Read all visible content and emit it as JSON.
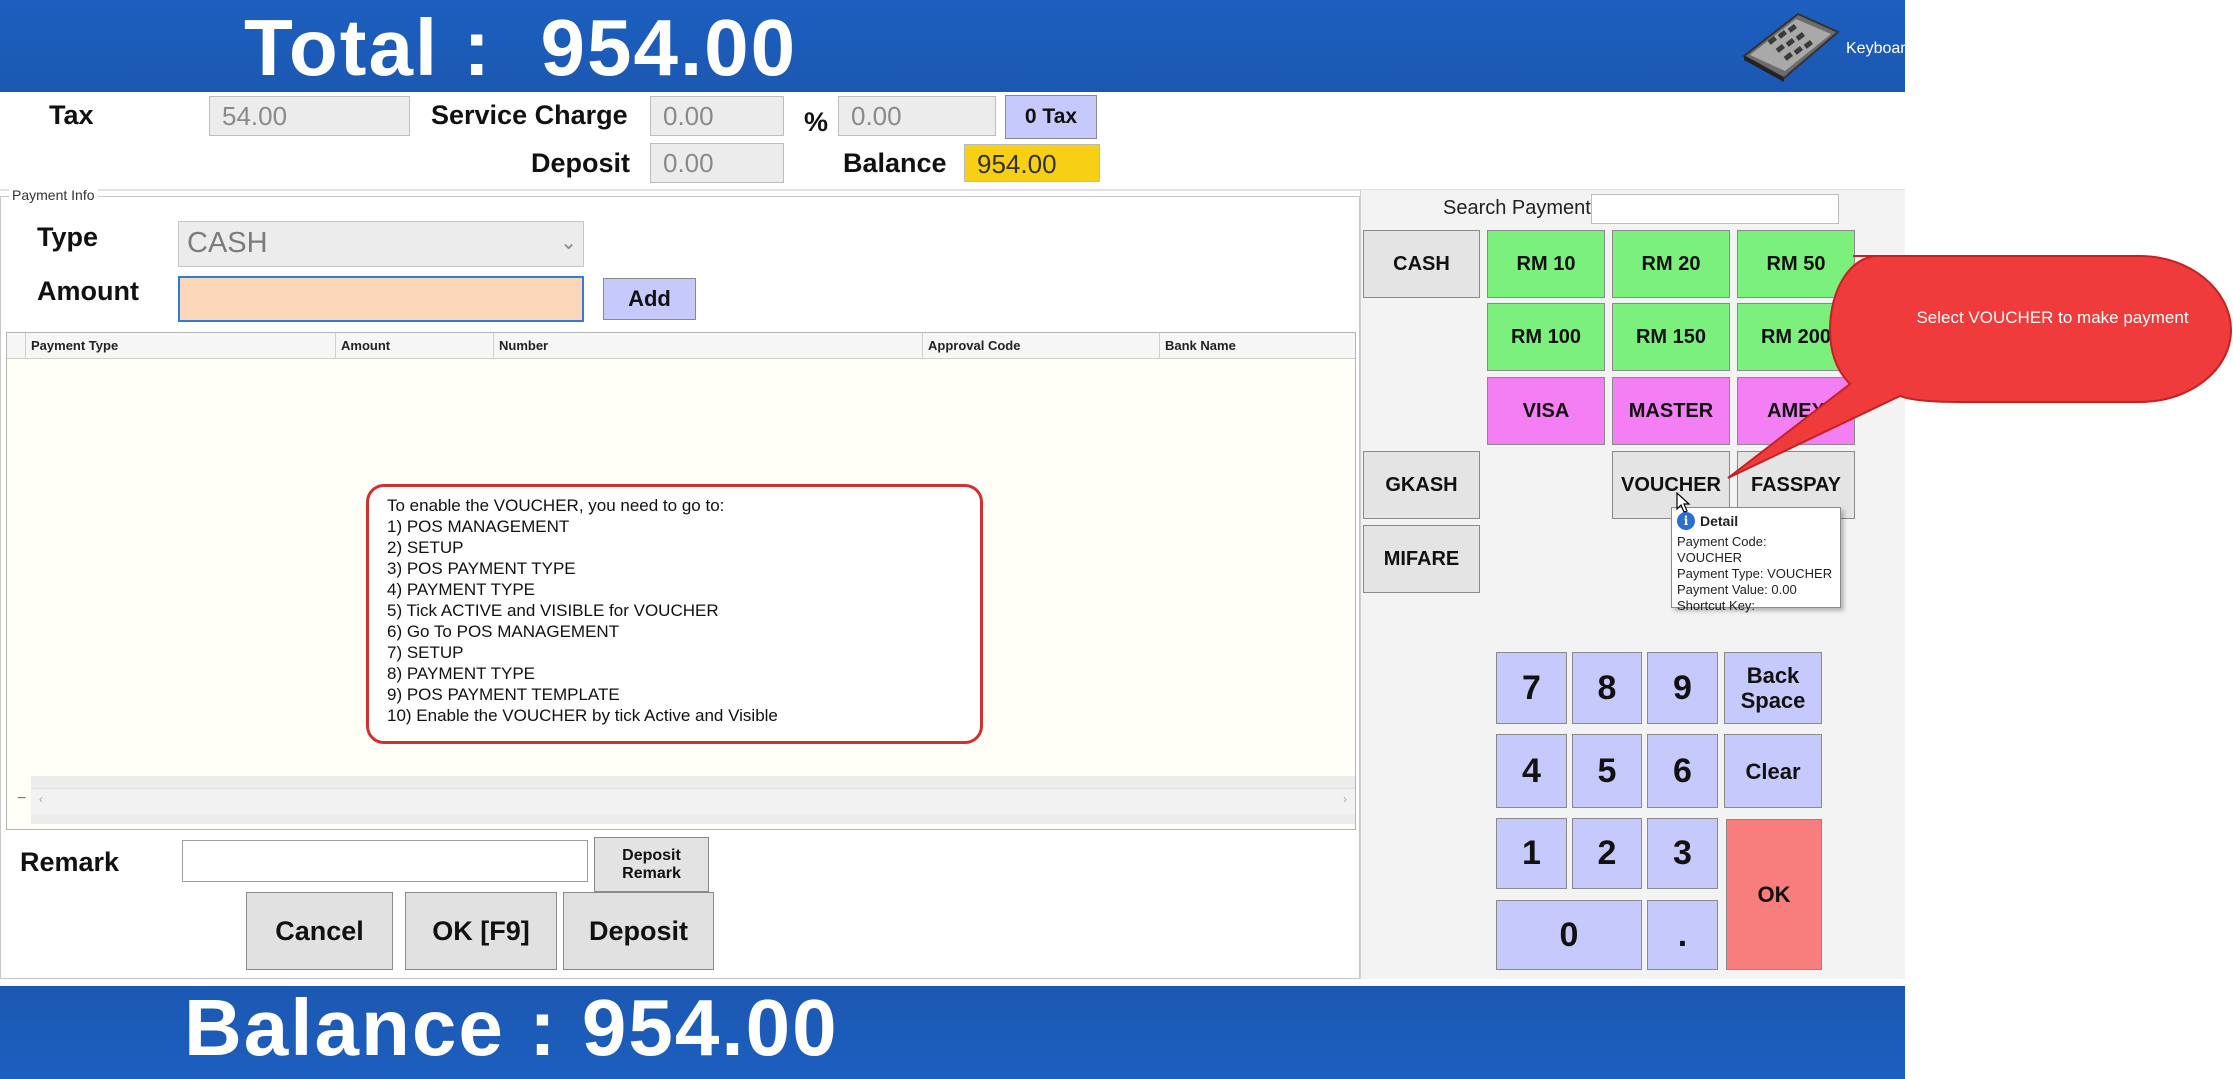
{
  "header": {
    "total_text": "Total :  954.00",
    "keyboard_label": "Keyboard"
  },
  "summary": {
    "tax_label": "Tax",
    "tax_value": "54.00",
    "service_charge_label": "Service Charge",
    "service_charge_value": "0.00",
    "percent_label": "%",
    "percent_value": "0.00",
    "zero_tax_button": "0 Tax",
    "deposit_label": "Deposit",
    "deposit_value": "0.00",
    "balance_label": "Balance",
    "balance_value": "954.00"
  },
  "payment_info": {
    "group_title": "Payment Info",
    "type_label": "Type",
    "type_value": "CASH",
    "amount_label": "Amount",
    "amount_value": "",
    "add_button": "Add",
    "columns": [
      "Payment Type",
      "Amount",
      "Number",
      "Approval Code",
      "Bank Name"
    ],
    "rows": [],
    "remark_label": "Remark",
    "remark_value": "",
    "deposit_remark_button": "Deposit Remark",
    "cancel_button": "Cancel",
    "ok_button": "OK [F9]",
    "deposit_button": "Deposit"
  },
  "instruction_note": {
    "lines": [
      "To enable the VOUCHER, you need to go to:",
      "1) POS MANAGEMENT",
      "2) SETUP",
      "3) POS PAYMENT TYPE",
      "4) PAYMENT TYPE",
      "5) Tick ACTIVE and VISIBLE for VOUCHER",
      "6) Go To POS MANAGEMENT",
      "7) SETUP",
      "8) PAYMENT TYPE",
      "9) POS PAYMENT TEMPLATE",
      "10) Enable the VOUCHER by tick Active and Visible"
    ]
  },
  "payment_panel": {
    "search_label": "Search Payment",
    "search_value": "",
    "buttons": {
      "cash": "CASH",
      "rm10": "RM 10",
      "rm20": "RM 20",
      "rm50": "RM 50",
      "rm100": "RM 100",
      "rm150": "RM 150",
      "rm200": "RM 200",
      "visa": "VISA",
      "master": "MASTER",
      "amex": "AMEX",
      "gkash": "GKASH",
      "voucher": "VOUCHER",
      "fasspay": "FASSPAY",
      "mifare": "MIFARE"
    },
    "colors": {
      "green": "#7cf07c",
      "pink": "#f47ef4",
      "keypad": "#c6c9fb",
      "ok": "#f87e7e",
      "balance": "#f7cf14",
      "banner": "#1d5fbf"
    }
  },
  "tooltip": {
    "title": "Detail",
    "line1": "Payment Code: VOUCHER",
    "line2": "Payment Type: VOUCHER",
    "line3": "Payment Value: 0.00",
    "line4": "Shortcut Key:"
  },
  "callout": {
    "text": "Select VOUCHER to make payment"
  },
  "keypad": {
    "k7": "7",
    "k8": "8",
    "k9": "9",
    "k4": "4",
    "k5": "5",
    "k6": "6",
    "k1": "1",
    "k2": "2",
    "k3": "3",
    "k0": "0",
    "dot": ".",
    "backspace": "Back Space",
    "clear": "Clear",
    "ok": "OK"
  },
  "footer": {
    "balance_text": "Balance : 954.00"
  }
}
